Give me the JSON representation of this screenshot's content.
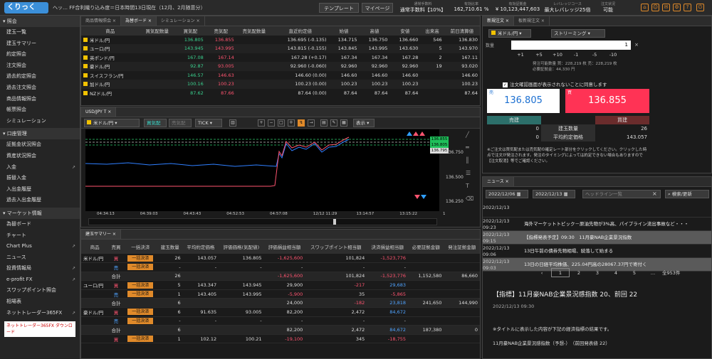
{
  "topbar": {
    "logo": "くりっく365",
    "marquee": "ヘッ… FF合利織り込み度＝日本時間13日現在（12月、2月随意分）",
    "template": "テンプレート",
    "mypage": "マイページ",
    "stats": [
      {
        "label": "通常手数料",
        "value": "通常手数料【10%】"
      },
      {
        "label": "有効比率",
        "value": "162,710.61 %"
      },
      {
        "label": "有効証拠金",
        "value": "¥ 10,123,447,603"
      },
      {
        "label": "レバレッジコース",
        "value": "最大レバレッジ25倍"
      },
      {
        "label": "注文状況",
        "value": "可能"
      }
    ]
  },
  "sidebar": {
    "section1": "照会",
    "items1": [
      "建玉一覧",
      "建玉サマリー",
      "約定照会",
      "注文照会",
      "過去約定照会",
      "過去注文照会",
      "商品情報照会",
      "帳票照会",
      "シミュレーション"
    ],
    "section2": "口座管理",
    "items2": [
      {
        "label": "証拠金状況照会",
        "ext": ""
      },
      {
        "label": "資産状況照会",
        "ext": ""
      },
      {
        "label": "入金",
        "ext": "↗"
      },
      {
        "label": "振替入金",
        "ext": ""
      },
      {
        "label": "入出金履歴",
        "ext": ""
      },
      {
        "label": "過去入出金履歴",
        "ext": ""
      }
    ],
    "section3": "マーケット情報",
    "items3": [
      {
        "label": "為替ボード",
        "ext": ""
      },
      {
        "label": "チャート",
        "ext": ""
      },
      {
        "label": "Chart Plus",
        "ext": "↗"
      },
      {
        "label": "ニュース",
        "ext": ""
      },
      {
        "label": "投資情報局",
        "ext": "↗"
      },
      {
        "label": "e-profit FX",
        "ext": "↗"
      },
      {
        "label": "スワップポイント照会",
        "ext": ""
      },
      {
        "label": "相場表",
        "ext": ""
      },
      {
        "label": "ネットトレーダー365FX",
        "ext": "↗"
      }
    ],
    "download": "ネットトレーダー365FX ダウンロード"
  },
  "rate_panel": {
    "tabs": [
      "商品情報照会",
      "為替ボード",
      "シミュレーション"
    ],
    "headers": [
      "商品",
      "買気配数量",
      "買気配",
      "売気配",
      "売気配数量",
      "直近約定値",
      "始値",
      "高値",
      "安値",
      "出来高",
      "前日清算値"
    ],
    "rows": [
      [
        "米ドル/円",
        "",
        "136.805",
        "136.855",
        "",
        "136.695 (-0.135)",
        "134.715",
        "136.750",
        "136.660",
        "546",
        "136.830"
      ],
      [
        "ユーロ/円",
        "",
        "143.945",
        "143.995",
        "",
        "143.815 (-0.155)",
        "143.845",
        "143.995",
        "143.630",
        "5",
        "143.970"
      ],
      [
        "英ポンド/円",
        "",
        "167.08",
        "167.14",
        "",
        "167.28 (+0.17)",
        "167.34",
        "167.34",
        "167.28",
        "2",
        "167.11"
      ],
      [
        "豪ドル/円",
        "",
        "92.87",
        "93.005",
        "",
        "92.960 (-0.060)",
        "92.960",
        "92.960",
        "92.960",
        "19",
        "93.020"
      ],
      [
        "スイスフラン/円",
        "",
        "146.57",
        "146.63",
        "",
        "146.60 (0.00)",
        "146.60",
        "146.60",
        "146.60",
        "",
        "146.60"
      ],
      [
        "加ドル/円",
        "",
        "100.16",
        "100.23",
        "",
        "100.23 (0.00)",
        "100.23",
        "100.23",
        "100.23",
        "",
        "100.23"
      ],
      [
        "NZドル/円",
        "",
        "87.62",
        "87.66",
        "",
        "87.64 (0.00)",
        "87.64",
        "87.64",
        "87.64",
        "",
        "87.64"
      ]
    ]
  },
  "chart_panel": {
    "tab": "USD/JPY T",
    "symbol": "米ドル/円",
    "bid_btn": "買気配",
    "ask_btn": "売気配",
    "tick": "TICK",
    "display": "表示",
    "price_labels": [
      "136.750",
      "136.500",
      "136.250"
    ],
    "tags": [
      "136.855",
      "136.805",
      "136.795"
    ],
    "time_labels": [
      "04:34:13",
      "04:39:03",
      "04:43:43",
      "04:52:53",
      "04:57:08",
      "12/12 11:29",
      "13:14:57",
      "13:15:22",
      "1"
    ]
  },
  "summary_panel": {
    "tab": "建玉サマリー",
    "headers": [
      "商品",
      "売買",
      "一括決済",
      "建玉数量",
      "平均約定価格",
      "評価価格(気配値)",
      "評価損益相当額",
      "スワップポイント相当額",
      "決済損益相当額",
      "必要証拠金額",
      "発注証拠金額"
    ],
    "button_label": "一括決済",
    "rows": [
      {
        "prod": "米ドル/円",
        "side": "買",
        "side_color": "#ff5470",
        "btn": true,
        "qty": "26",
        "avg": "143.057",
        "eval": "136.805",
        "pl": "-1,625,600",
        "swap": "101,824",
        "spl": "-1,523,776",
        "req": "",
        "ord": ""
      },
      {
        "prod": "",
        "side": "売",
        "side_color": "#4fa3ff",
        "btn": true,
        "qty": "-",
        "avg": "-",
        "eval": "-",
        "pl": "-",
        "swap": "-",
        "spl": "-",
        "req": "",
        "ord": ""
      },
      {
        "prod": "",
        "side": "合計",
        "side_color": "#ddd",
        "btn": false,
        "qty": "26",
        "avg": "",
        "eval": "",
        "pl": "-1,625,600",
        "swap": "101,824",
        "spl": "-1,523,776",
        "req": "1,152,580",
        "ord": "86,660"
      },
      {
        "prod": "ユーロ/円",
        "side": "買",
        "side_color": "#ff5470",
        "btn": true,
        "qty": "5",
        "avg": "143.347",
        "eval": "143.945",
        "pl": "29,900",
        "swap": "-217",
        "spl": "29,683",
        "req": "",
        "ord": ""
      },
      {
        "prod": "",
        "side": "売",
        "side_color": "#4fa3ff",
        "btn": true,
        "qty": "1",
        "avg": "143.405",
        "eval": "143.995",
        "pl": "-5,900",
        "swap": "35",
        "spl": "-5,865",
        "req": "",
        "ord": ""
      },
      {
        "prod": "",
        "side": "合計",
        "side_color": "#ddd",
        "btn": false,
        "qty": "6",
        "avg": "",
        "eval": "",
        "pl": "24,000",
        "swap": "-182",
        "spl": "23,818",
        "req": "241,650",
        "ord": "144,990"
      },
      {
        "prod": "豪ドル/円",
        "side": "買",
        "side_color": "#ff5470",
        "btn": true,
        "qty": "6",
        "avg": "91.635",
        "eval": "93.005",
        "pl": "82,200",
        "swap": "2,472",
        "spl": "84,672",
        "req": "",
        "ord": ""
      },
      {
        "prod": "",
        "side": "売",
        "side_color": "#4fa3ff",
        "btn": true,
        "qty": "-",
        "avg": "-",
        "eval": "-",
        "pl": "-",
        "swap": "-",
        "spl": "-",
        "req": "",
        "ord": ""
      },
      {
        "prod": "",
        "side": "合計",
        "side_color": "#ddd",
        "btn": false,
        "qty": "6",
        "avg": "",
        "eval": "",
        "pl": "82,200",
        "swap": "2,472",
        "spl": "84,672",
        "req": "187,380",
        "ord": "0"
      },
      {
        "prod": "",
        "side": "買",
        "side_color": "#ff5470",
        "btn": true,
        "qty": "1",
        "avg": "102.12",
        "eval": "100.21",
        "pl": "-19,100",
        "swap": "345",
        "spl": "-18,755",
        "req": "",
        "ord": ""
      }
    ]
  },
  "new_order": {
    "tabs": [
      "新規注文",
      "板新規注文"
    ],
    "symbol": "米ドル/円",
    "type": "ストリーミング",
    "qty_label": "数量",
    "qty": "1",
    "steps": [
      "+1",
      "+5",
      "+10",
      "-1",
      "-5",
      "-10"
    ],
    "info": [
      "発注可能数量 買：228,219 枚 売：228,219 枚",
      "必要証拠金：44,330 円"
    ],
    "confirm": "注文確認画面が表示されないことに同意します",
    "sell_label": "売",
    "sell_price": "136.805",
    "buy_label": "買",
    "buy_price": "136.855",
    "table": {
      "sell": "売建",
      "buy": "買建",
      "r1": [
        "0",
        "建玉数量",
        "26"
      ],
      "r2": [
        "0",
        "平均約定価格",
        "143.057"
      ]
    },
    "note": "※ご注文は買気配または売気配の確定レート部分をクリックしてください。クリックした時点で注文が発注されます。発注のタイミングによっては約定できない場合もありますので【注文取消】等でご確認ください。"
  },
  "news": {
    "tab": "ニュース",
    "date_from": "2022/12/06",
    "date_to": "2022/12/13",
    "headline_ph": "ヘッドライン一覧",
    "search": "検索/更新",
    "items": [
      {
        "t": "2022/12/13",
        "h": ""
      },
      {
        "t": "2022/12/13 09:23",
        "h": "海外マーケットトピック－原油先物が3%高、パイプライン流出事故など・・・"
      },
      {
        "t": "2022/12/13 09:15",
        "h": "【指標発表予定】09:30　11月豪NAB企業景況指数"
      },
      {
        "t": "2022/12/13 09:06",
        "h": "13日午前の債券先物相場、続落して始まる"
      },
      {
        "t": "2022/12/13 09:03",
        "h": "13日の日経平均株価、225.04円高の28067.37円で寄付く"
      }
    ],
    "pages": [
      "1",
      "2",
      "3",
      "4",
      "5",
      "…",
      "全953件"
    ],
    "detail_title": "【指標】11月豪NAB企業景況感指数 20、前回 22",
    "detail_time": "2022/12/13 09:30",
    "detail_body": "※タイトルに表示した内容が下記の経済指標の結果です。",
    "detail_body2": "11月豪NAB企業景況感指数（予想-）　（前回発表値 22）"
  }
}
